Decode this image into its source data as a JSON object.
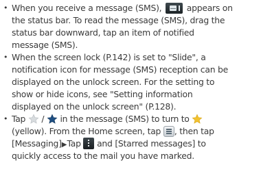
{
  "notes": [
    {
      "bullet": "•",
      "lines": [
        {
          "before": "When you receive a message (SMS), ",
          "after": " appears on",
          "icon": "message-status-icon"
        },
        {
          "text": "the status bar. To read the message (SMS), drag the"
        },
        {
          "text": "status bar downward, tap an item of notified"
        },
        {
          "text": "message (SMS)."
        }
      ]
    },
    {
      "bullet": "•",
      "lines": [
        {
          "text": "When the screen lock (P.142) is set to \"Slide\", a"
        },
        {
          "text": "notification icon for message (SMS) reception can be"
        },
        {
          "text": "displayed on the unlock screen. For the setting to"
        },
        {
          "text": "show or hide icons, see \"Setting information"
        },
        {
          "text": "displayed on the unlock screen\" (P.128)."
        }
      ]
    },
    {
      "bullet": "•",
      "lines": [
        {
          "p1": "Tap ",
          "p2": " / ",
          "p3": " in the message (SMS) to turn to "
        },
        {
          "p1": "(yellow). From the Home screen, tap ",
          "p2": ", then tap"
        },
        {
          "p1": "[Messaging]",
          "arrow": "▶",
          "p2": "Tap ",
          "p3": " and [Starred messages] to"
        },
        {
          "text": "quickly access to the mail you have marked."
        }
      ]
    }
  ],
  "icons": {
    "status_message": "envelope-status-icon",
    "star_off": "star-outline-icon",
    "star_on_dark": "star-filled-icon",
    "star_yellow": "star-yellow-icon",
    "menu_key": "menu-key-icon",
    "overflow": "overflow-menu-icon"
  },
  "colors": {
    "text": "#3a3a3a",
    "star_off": "#cfd3d6",
    "star_on": "#1f4f82",
    "star_yellow": "#f2c230"
  }
}
